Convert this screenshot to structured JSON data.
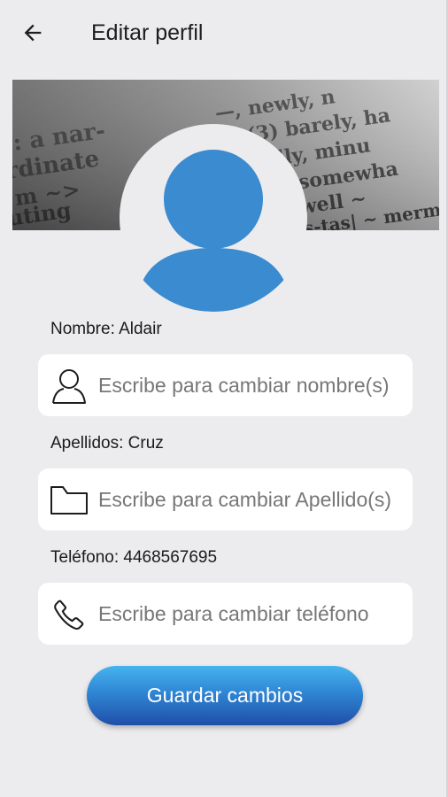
{
  "appbar": {
    "back_icon": "arrow-left-icon",
    "title": "Editar perfil"
  },
  "banner": {
    "image": "dictionary-page-photo",
    "description_icon": "cover-photo"
  },
  "avatar": {
    "icon": "user-avatar-icon",
    "color": "#3a8bd0"
  },
  "fields": [
    {
      "label": "Nombre: Aldair",
      "icon": "person-outline-icon",
      "value": "",
      "placeholder": "Escribe para cambiar nombre(s)"
    },
    {
      "label": "Apellidos: Cruz",
      "icon": "folder-outline-icon",
      "value": "",
      "placeholder": "Escribe para cambiar Apellido(s)"
    },
    {
      "label": "Teléfono: 4468567695",
      "icon": "phone-outline-icon",
      "value": "",
      "placeholder": "Escribe para cambiar teléfono"
    }
  ],
  "save_button": {
    "label": "Guardar cambios",
    "colors": [
      "#46b3ee",
      "#1f4fa8"
    ]
  }
}
